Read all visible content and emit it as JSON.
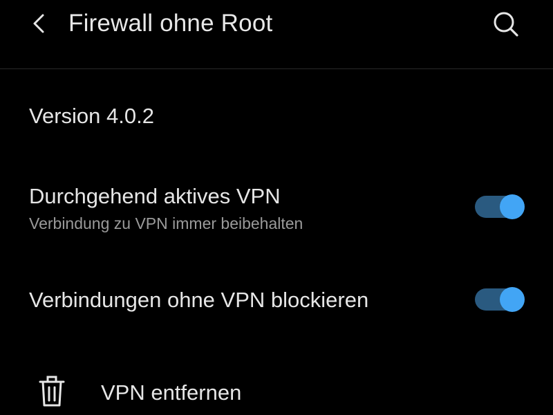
{
  "appbar": {
    "title": "Firewall ohne Root",
    "back_icon": "chevron-left-icon",
    "search_icon": "search-icon"
  },
  "settings": {
    "version_text": "Version 4.0.2",
    "always_on_vpn": {
      "title": "Durchgehend aktives VPN",
      "subtitle": "Verbindung zu VPN immer beibehalten",
      "enabled": true
    },
    "block_without_vpn": {
      "title": "Verbindungen ohne VPN blockieren",
      "enabled": true
    },
    "remove_vpn": {
      "label": "VPN entfernen",
      "icon": "trash-icon"
    }
  },
  "colors": {
    "background": "#000000",
    "text_primary": "#e6e6e6",
    "text_secondary": "#9a9a9a",
    "toggle_track": "#2a5a80",
    "toggle_thumb": "#42a5f5"
  }
}
